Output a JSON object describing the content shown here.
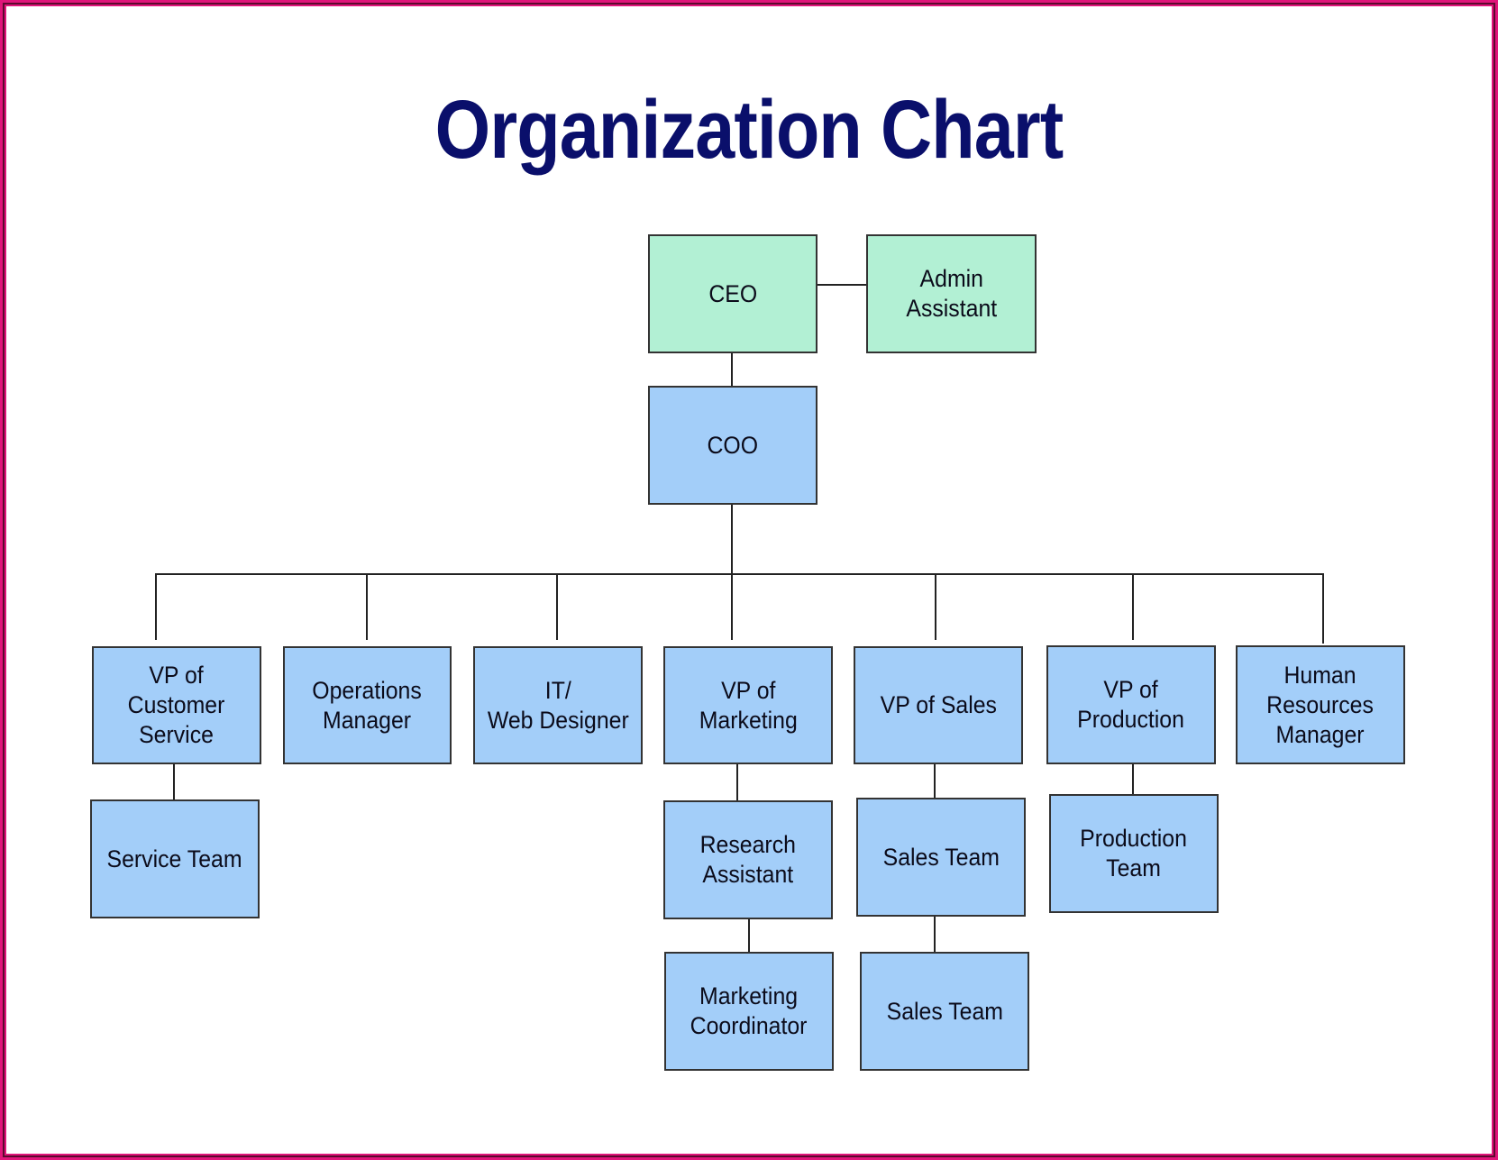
{
  "title": "Organization Chart",
  "colors": {
    "title": "#0a0f6b",
    "executive_box": "#b2f0d4",
    "staff_box": "#a3cef9",
    "frame": "#e0157a"
  },
  "nodes": {
    "ceo": "CEO",
    "admin_assistant": "Admin\nAssistant",
    "coo": "COO",
    "vp_customer_service": "VP of\nCustomer\nService",
    "operations_manager": "Operations\nManager",
    "it_web_designer": "IT/\nWeb Designer",
    "vp_marketing": "VP of\nMarketing",
    "vp_sales": "VP of Sales",
    "vp_production": "VP of\nProduction",
    "hr_manager": "Human\nResources\nManager",
    "service_team": "Service Team",
    "research_assistant": "Research\nAssistant",
    "sales_team_1": "Sales Team",
    "production_team": "Production\nTeam",
    "marketing_coordinator": "Marketing\nCoordinator",
    "sales_team_2": "Sales Team"
  },
  "hierarchy": {
    "CEO": [
      "Admin Assistant",
      "COO"
    ],
    "COO": [
      "VP of Customer Service",
      "Operations Manager",
      "IT/ Web Designer",
      "VP of Marketing",
      "VP of Sales",
      "VP of Production",
      "Human Resources Manager"
    ],
    "VP of Customer Service": [
      "Service Team"
    ],
    "VP of Marketing": [
      "Research Assistant"
    ],
    "Research Assistant": [
      "Marketing Coordinator"
    ],
    "VP of Sales": [
      "Sales Team"
    ],
    "Sales Team": [
      "Sales Team"
    ],
    "VP of Production": [
      "Production Team"
    ]
  }
}
